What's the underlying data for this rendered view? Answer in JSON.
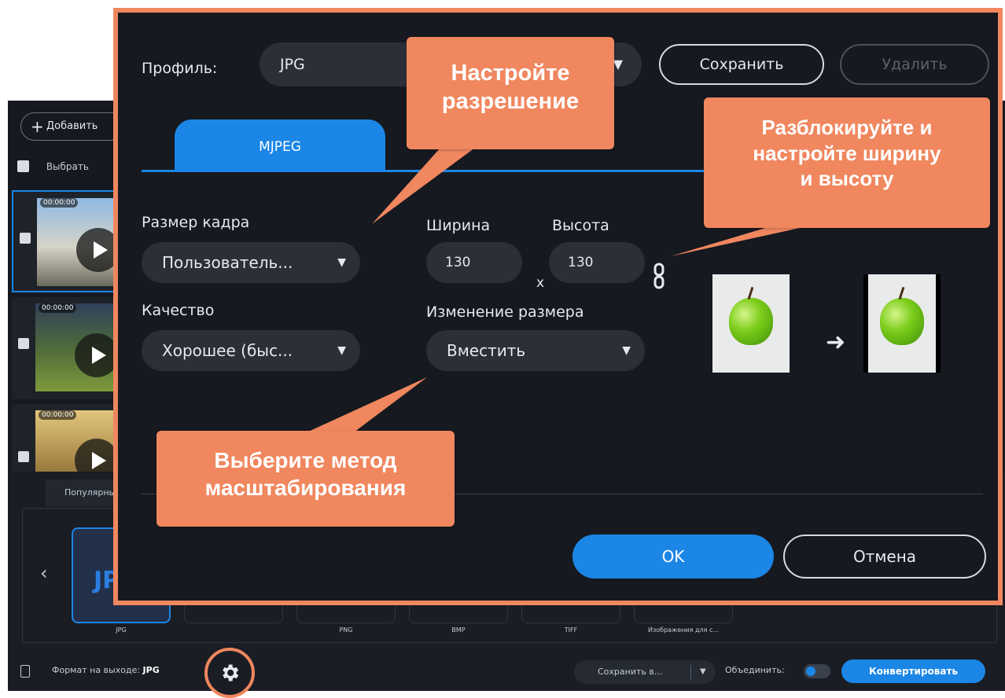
{
  "background_app": {
    "add_button_label": "Добавить",
    "select_row_label": "Выбрать",
    "files": [
      {
        "time": "00:00:00"
      },
      {
        "time": "00:00:00"
      },
      {
        "time": "00:00:00"
      }
    ],
    "format_tab": "Популярные",
    "format_tiles": [
      {
        "label": "JPG",
        "big_text": "JPG"
      },
      {
        "label": ""
      },
      {
        "label": "PNG"
      },
      {
        "label": "BMP"
      },
      {
        "label": "TIFF"
      },
      {
        "label": "Изображения для с..."
      }
    ],
    "bottom_bar": {
      "output_format_label": "Формат на выходе:",
      "output_format_value": "JPG",
      "save_to_label": "Сохранить в...",
      "merge_label": "Объединить:",
      "convert_label": "Конвертировать"
    }
  },
  "dialog": {
    "profile_label": "Профиль:",
    "profile_value": "JPG",
    "save_label": "Сохранить",
    "delete_label": "Удалить",
    "tab_label": "MJPEG",
    "frame_size_label": "Размер кадра",
    "frame_size_value": "Пользователь...",
    "width_label": "Ширина",
    "height_label": "Высота",
    "width_value": "130",
    "height_value": "130",
    "times_sign": "x",
    "quality_label": "Качество",
    "quality_value": "Хорошее (быс...",
    "resize_label": "Изменение размера",
    "resize_value": "Вместить",
    "ok_label": "OK",
    "cancel_label": "Отмена"
  },
  "callouts": {
    "resolution": [
      "Настройте",
      "разрешение"
    ],
    "unlock": [
      "Разблокируйте и",
      "настройте ширину",
      "и высоту"
    ],
    "scaling": [
      "Выберите метод",
      "масштабирования"
    ]
  },
  "colors": {
    "accent": "#1b86e6",
    "callout": "#f0875f",
    "dialog_bg": "#16191f"
  }
}
